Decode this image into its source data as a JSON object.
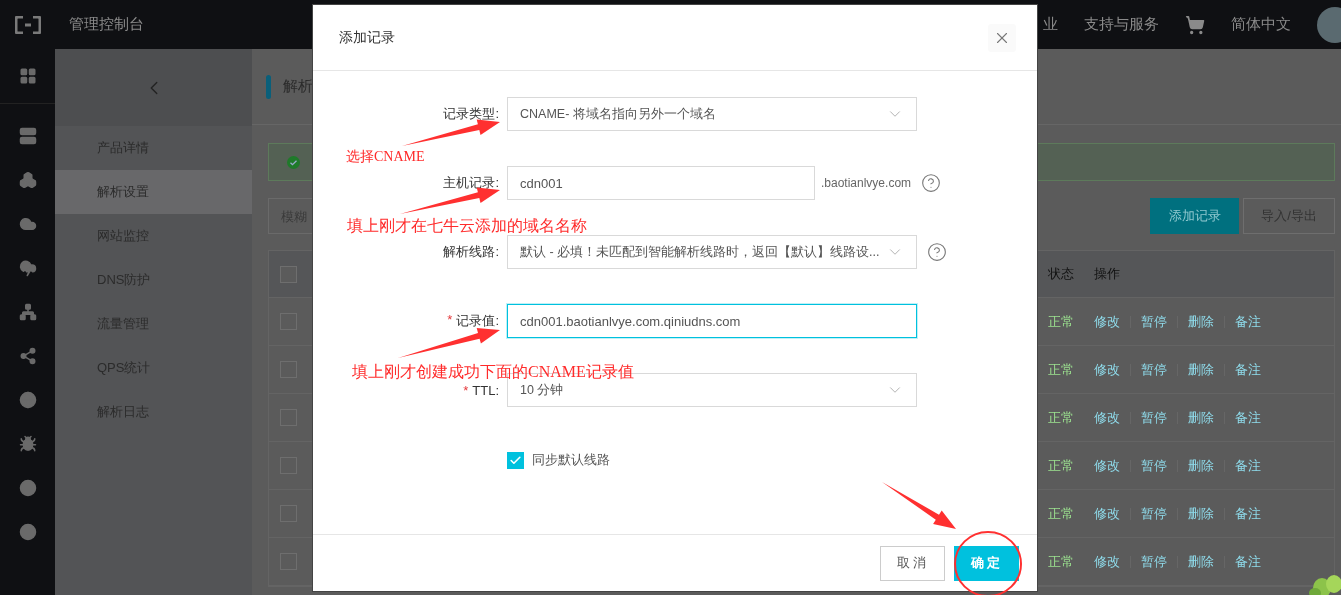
{
  "top_bar": {
    "title": "管理控制台",
    "links": [
      "业",
      "支持与服务",
      "简体中文"
    ]
  },
  "nav": {
    "items": [
      {
        "label": "产品详情",
        "selected": false
      },
      {
        "label": "解析设置",
        "selected": true
      },
      {
        "label": "网站监控",
        "selected": false
      },
      {
        "label": "DNS防护",
        "selected": false
      },
      {
        "label": "流量管理",
        "selected": false
      },
      {
        "label": "QPS统计",
        "selected": false
      },
      {
        "label": "解析日志",
        "selected": false
      }
    ]
  },
  "page": {
    "title": "解析",
    "search_placeholder": "模糊",
    "buttons": [
      {
        "label": "添加记录",
        "primary": true
      },
      {
        "label": "导入/导出",
        "primary": false
      }
    ]
  },
  "table": {
    "columns": [
      "状态",
      "操作"
    ],
    "header_checked": false,
    "rows": [
      {
        "checked": false,
        "status": "正常",
        "actions": [
          "修改",
          "暂停",
          "删除",
          "备注"
        ]
      },
      {
        "checked": false,
        "status": "正常",
        "actions": [
          "修改",
          "暂停",
          "删除",
          "备注"
        ]
      },
      {
        "checked": false,
        "status": "正常",
        "actions": [
          "修改",
          "暂停",
          "删除",
          "备注"
        ]
      },
      {
        "checked": false,
        "status": "正常",
        "actions": [
          "修改",
          "暂停",
          "删除",
          "备注"
        ]
      },
      {
        "checked": false,
        "status": "正常",
        "actions": [
          "修改",
          "暂停",
          "删除",
          "备注"
        ]
      },
      {
        "checked": false,
        "status": "正常",
        "actions": [
          "修改",
          "暂停",
          "删除",
          "备注"
        ]
      }
    ]
  },
  "dialog": {
    "title": "添加记录",
    "fields": [
      {
        "kind": "select",
        "label": "记录类型:",
        "value": "CNAME- 将域名指向另外一个域名",
        "help": false,
        "focused": false
      },
      {
        "kind": "input",
        "label": "主机记录:",
        "value": "cdn001",
        "suffix": ".baotianlvye.com",
        "help": true,
        "focused": false
      },
      {
        "kind": "select",
        "label": "解析线路:",
        "value": "默认 - 必填！未匹配到智能解析线路时，返回【默认】线路设...",
        "help": true,
        "focused": false
      },
      {
        "kind": "input",
        "required_mark": "*",
        "label": "记录值:",
        "value": "cdn001.baotianlvye.com.qiniudns.com",
        "help": false,
        "focused": true
      },
      {
        "kind": "select",
        "required_mark": "*",
        "label": "TTL:",
        "value": "10 分钟",
        "help": false,
        "focused": false
      }
    ],
    "sync": {
      "label": "同步默认线路",
      "checked": true
    },
    "buttons": [
      {
        "label": "取消",
        "primary": false
      },
      {
        "label": "确定",
        "primary": true
      }
    ]
  },
  "annotations": [
    {
      "text": "选择CNAME"
    },
    {
      "text": "填上刚才在七牛云添加的域名名称"
    },
    {
      "text": "填上刚才创建成功下面的CNAME记录值"
    }
  ]
}
